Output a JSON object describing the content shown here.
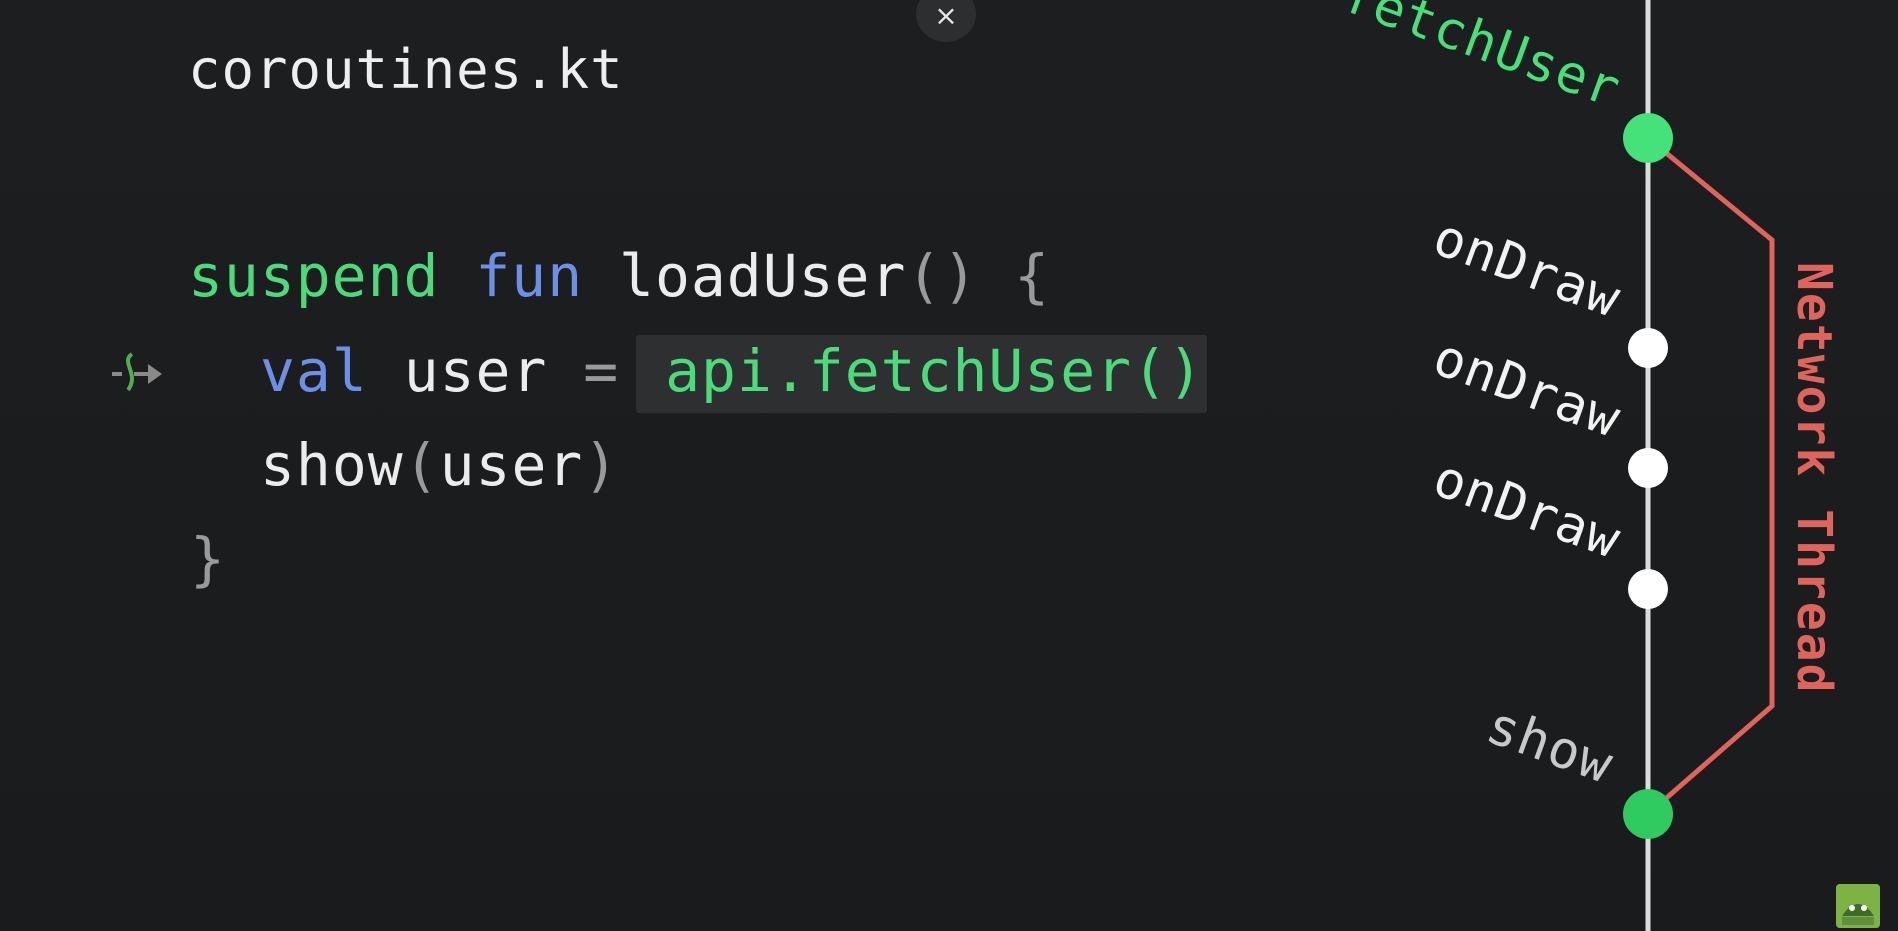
{
  "editor": {
    "filename": "coroutines.kt",
    "line1": {
      "kw_suspend": "suspend",
      "kw_fun": "fun",
      "name": "loadUser",
      "parens": "()",
      "brace": "{"
    },
    "line2": {
      "kw_val": "val",
      "ident": "user",
      "equals": "=",
      "call": "api.fetchUser()"
    },
    "line3": {
      "fn": "show",
      "open": "(",
      "arg": "user",
      "close": ")"
    },
    "line4": {
      "brace": "}"
    }
  },
  "timeline": {
    "labels": {
      "fetch": "fetchUser",
      "draw1": "onDraw",
      "draw2": "onDraw",
      "draw3": "onDraw",
      "show": "show"
    },
    "network_label": "Network Thread"
  },
  "close_button": {
    "glyph": "×"
  },
  "colors": {
    "background": "#1a1c1e",
    "green_keyword": "#4cdb7a",
    "blue_keyword": "#6d8fe6",
    "network_red": "#e0635c"
  }
}
